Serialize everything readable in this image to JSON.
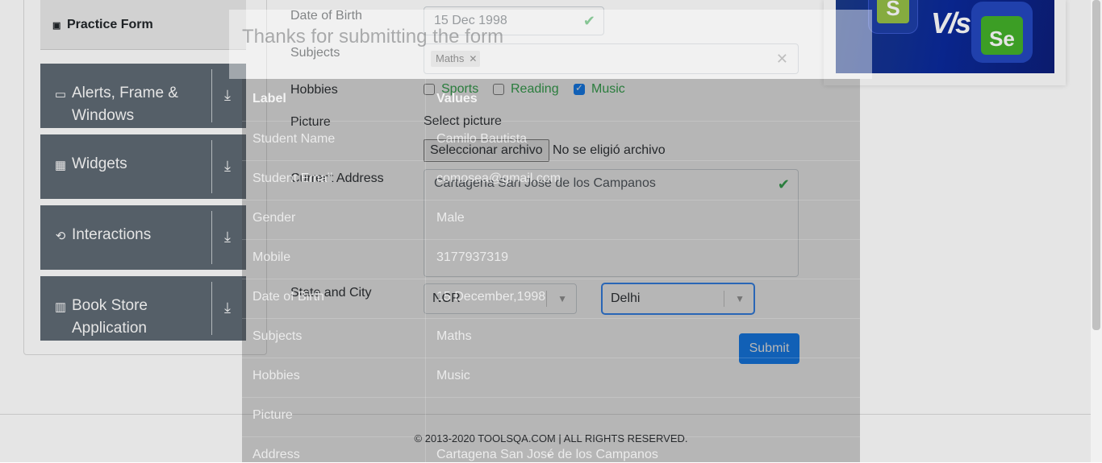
{
  "sidebar": {
    "active_item": "Practice Form",
    "groups": [
      {
        "label": "Alerts, Frame & Windows"
      },
      {
        "label": "Widgets"
      },
      {
        "label": "Interactions"
      },
      {
        "label": "Book Store Application"
      }
    ]
  },
  "form": {
    "dob_label": "Date of Birth",
    "dob_value": "15 Dec 1998",
    "subjects_label": "Subjects",
    "subject_chip": "Maths",
    "hobbies_label": "Hobbies",
    "hobbies": [
      {
        "label": "Sports",
        "checked": false
      },
      {
        "label": "Reading",
        "checked": false
      },
      {
        "label": "Music",
        "checked": true
      }
    ],
    "picture_label": "Picture",
    "picture_hint": "Select picture",
    "file_button": "Seleccionar archivo",
    "file_status": "No se eligió archivo",
    "address_label": "Current Address",
    "address_value": "Cartagena San José de los Campanos",
    "state_city_label": "State and City",
    "state_value": "NCR",
    "city_value": "Delhi",
    "submit_label": "Submit"
  },
  "modal": {
    "title": "Thanks for submitting the form",
    "header_label": "Label",
    "header_values": "Values",
    "rows": [
      {
        "label": "Student Name",
        "value": "Camilo Bautista"
      },
      {
        "label": "Student Email",
        "value": "comosea@gmail.com"
      },
      {
        "label": "Gender",
        "value": "Male"
      },
      {
        "label": "Mobile",
        "value": "3177937319"
      },
      {
        "label": "Date of Birth",
        "value": "15 December,1998"
      },
      {
        "label": "Subjects",
        "value": "Maths"
      },
      {
        "label": "Hobbies",
        "value": "Music"
      },
      {
        "label": "Picture",
        "value": ""
      },
      {
        "label": "Address",
        "value": "Cartagena San José de los Campanos"
      }
    ]
  },
  "footer": {
    "text": "© 2013-2020 TOOLSQA.COM | ALL RIGHTS RESERVED."
  },
  "banner": {
    "vs_text": "V/s",
    "left_logo": "S",
    "right_logo": "Se"
  },
  "colors": {
    "accent": "#007bff",
    "success": "#28a745",
    "sidebar_dark": "#5f6a74"
  }
}
